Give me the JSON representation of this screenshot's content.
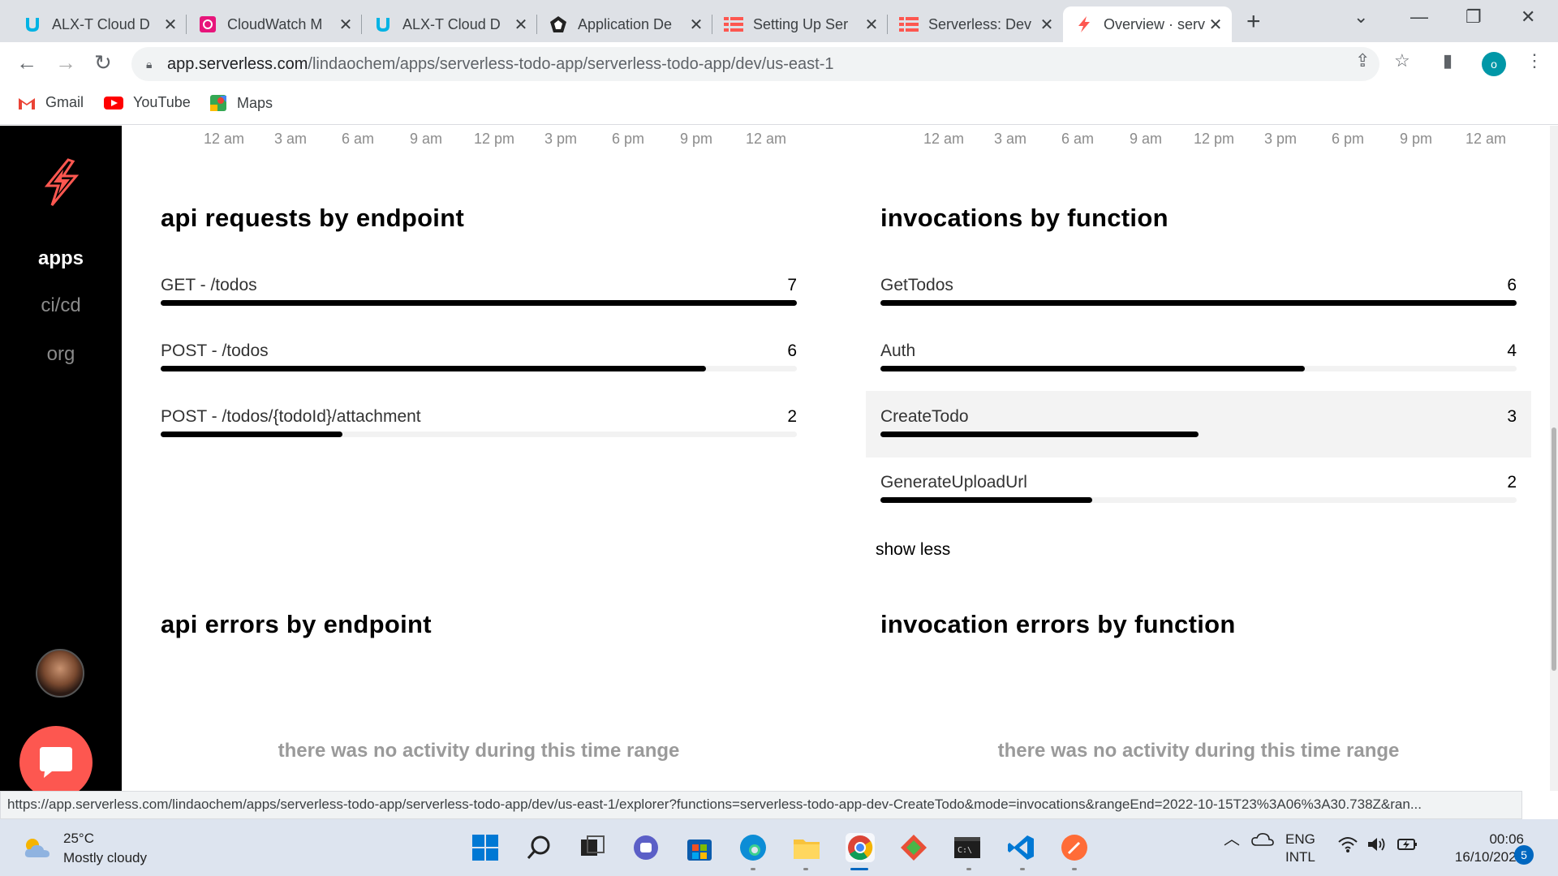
{
  "browser": {
    "tabs": [
      {
        "title": "ALX-T Cloud D",
        "icon": "udacity-icon"
      },
      {
        "title": "CloudWatch M",
        "icon": "cloudwatch-icon"
      },
      {
        "title": "ALX-T Cloud D",
        "icon": "udacity-icon"
      },
      {
        "title": "Application De",
        "icon": "auth0-icon"
      },
      {
        "title": "Setting Up Ser",
        "icon": "serverless-icon"
      },
      {
        "title": "Serverless: Dev",
        "icon": "serverless-icon"
      },
      {
        "title": "Overview · serv",
        "icon": "serverless-bolt-icon",
        "active": true
      }
    ],
    "new_tab": "+",
    "url_host": "app.serverless.com",
    "url_path": "/lindaochem/apps/serverless-todo-app/serverless-todo-app/dev/us-east-1",
    "profile_initial": "o",
    "bookmarks": [
      "Gmail",
      "YouTube",
      "Maps"
    ],
    "status_url": "https://app.serverless.com/lindaochem/apps/serverless-todo-app/serverless-todo-app/dev/us-east-1/explorer?functions=serverless-todo-app-dev-CreateTodo&mode=invocations&rangeEnd=2022-10-15T23%3A06%3A30.738Z&ran..."
  },
  "sidebar": {
    "items": [
      {
        "label": "apps",
        "active": true
      },
      {
        "label": "ci/cd",
        "active": false
      },
      {
        "label": "org",
        "active": false
      }
    ]
  },
  "time_ticks": [
    "12 am",
    "3 am",
    "6 am",
    "9 am",
    "12 pm",
    "3 pm",
    "6 pm",
    "9 pm",
    "12 am"
  ],
  "api_requests": {
    "title": "api requests by endpoint",
    "rows": [
      {
        "label": "GET - /todos",
        "value": 7,
        "fraction": 1.0
      },
      {
        "label": "POST - /todos",
        "value": 6,
        "fraction": 0.857
      },
      {
        "label": "POST - /todos/{todoId}/attachment",
        "value": 2,
        "fraction": 0.286
      }
    ]
  },
  "invocations": {
    "title": "invocations by function",
    "rows": [
      {
        "label": "GetTodos",
        "value": 6,
        "fraction": 1.0
      },
      {
        "label": "Auth",
        "value": 4,
        "fraction": 0.667
      },
      {
        "label": "CreateTodo",
        "value": 3,
        "fraction": 0.5
      },
      {
        "label": "GenerateUploadUrl",
        "value": 2,
        "fraction": 0.333
      }
    ],
    "show_less": "show less"
  },
  "api_errors": {
    "title": "api errors by endpoint",
    "empty": "there was no activity during this time range"
  },
  "invocation_errors": {
    "title": "invocation errors by function",
    "empty": "there was no activity during this time range"
  },
  "taskbar": {
    "temp": "25°C",
    "weather": "Mostly cloudy",
    "lang1": "ENG",
    "lang2": "INTL",
    "time": "00:06",
    "date": "16/10/2022",
    "notifications": "5"
  },
  "colors": {
    "brand": "#fd5750",
    "sidebar_bg": "#000000",
    "bar_fill": "#000000",
    "bar_track": "#f2f2f2"
  }
}
